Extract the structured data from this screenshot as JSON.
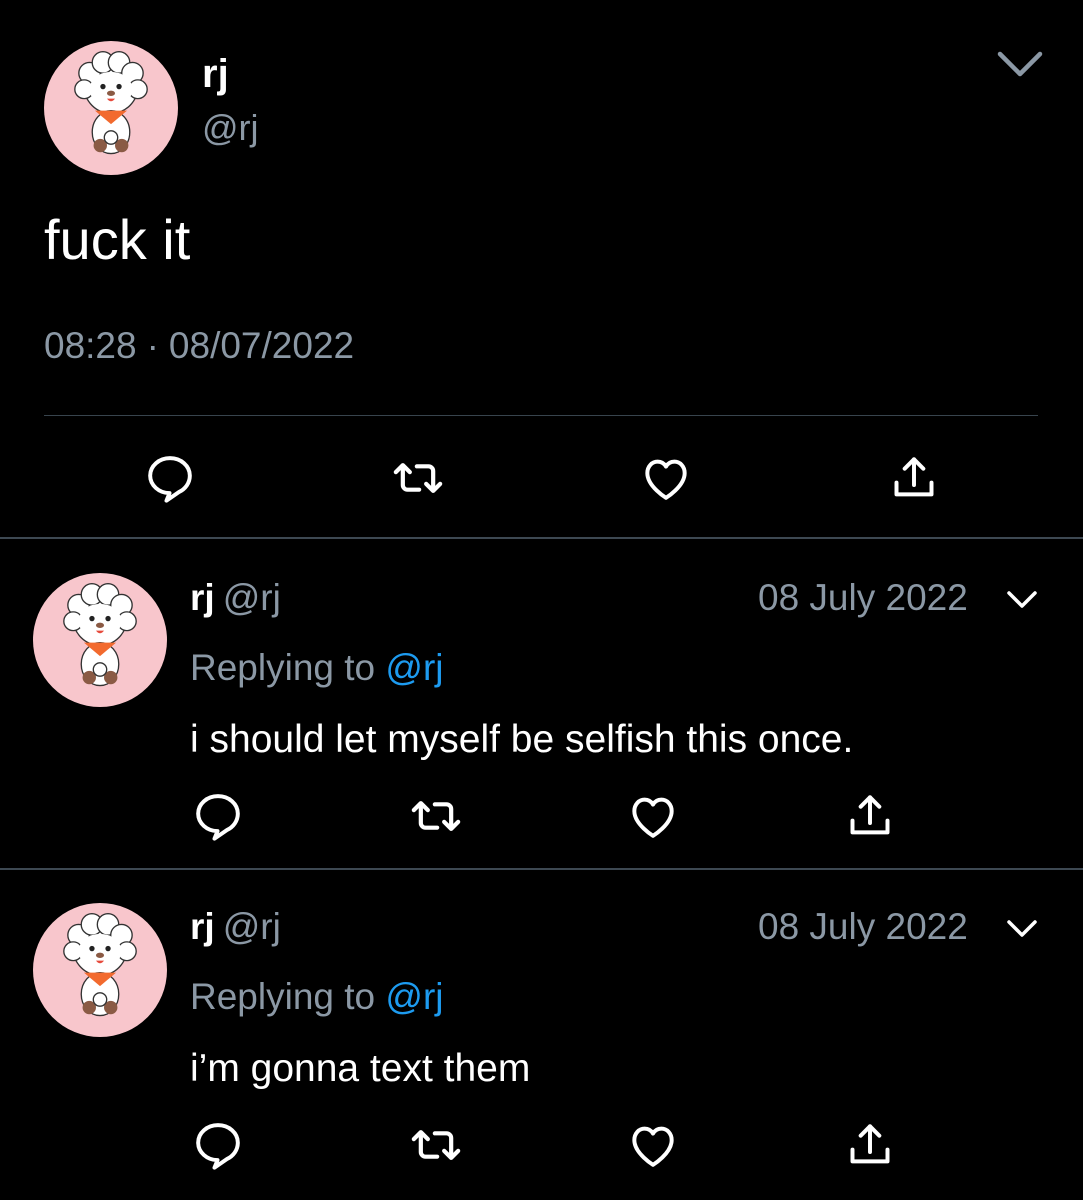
{
  "main_tweet": {
    "name": "rj",
    "handle": "@rj",
    "text": "fuck it",
    "time": "08:28",
    "separator": "·",
    "date": "08/07/2022"
  },
  "replies": [
    {
      "name": "rj",
      "handle": "@rj",
      "date": "08 July 2022",
      "replying_prefix": "Replying to",
      "replying_mention": "@rj",
      "text": "i should let myself be selfish this once."
    },
    {
      "name": "rj",
      "handle": "@rj",
      "date": "08 July 2022",
      "replying_prefix": "Replying to",
      "replying_mention": "@rj",
      "text": "i’m gonna text them"
    }
  ],
  "actions": [
    "reply-icon",
    "retweet-icon",
    "like-icon",
    "share-icon"
  ],
  "colors": {
    "background": "#000000",
    "secondary_text": "#8b98a5",
    "mention": "#1d9bf0",
    "avatar_bg": "#f8c6cc"
  }
}
